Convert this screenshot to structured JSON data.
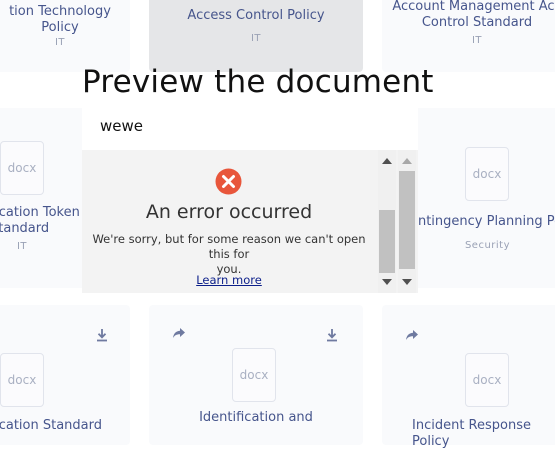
{
  "cards": [
    {
      "id": "c1",
      "title_lines": [
        "tion Technology",
        "Policy"
      ],
      "category": "IT"
    },
    {
      "id": "c2",
      "title_lines": [
        "Access Control Policy"
      ],
      "category": "IT"
    },
    {
      "id": "c3",
      "title_lines": [
        "Account Management Acc",
        "Control Standard"
      ],
      "category": "IT"
    },
    {
      "id": "c4",
      "file_type": "docx",
      "title_lines": [
        "tication Token",
        "Standard"
      ],
      "category": "IT"
    },
    {
      "id": "c5",
      "file_type": "docx",
      "title_lines": [
        "ontingency Planning Poli"
      ],
      "category": "Security"
    },
    {
      "id": "c6",
      "file_type": "docx",
      "title_lines": [
        "tication Standard"
      ]
    },
    {
      "id": "c7",
      "file_type": "docx",
      "title_lines": [
        "Identification and"
      ]
    },
    {
      "id": "c8",
      "file_type": "docx",
      "title_lines": [
        "Incident Response Policy"
      ]
    }
  ],
  "modal": {
    "title": "Preview the document",
    "filename": "wewe",
    "error": {
      "title": "An error occurred",
      "message_line1": "We're sorry, but for some reason we can't open this for",
      "message_line2": "you.",
      "link": "Learn more"
    }
  },
  "icons": {
    "download": "download-icon",
    "share": "share-icon",
    "error": "error-circle-icon"
  },
  "colors": {
    "card_text": "#46558c",
    "error_red": "#e8563b",
    "link": "#0c1f8a"
  }
}
